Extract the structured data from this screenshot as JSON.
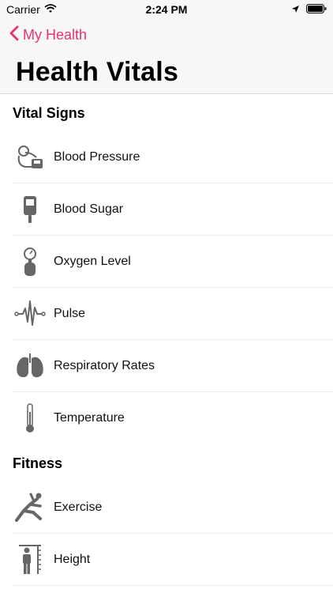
{
  "status_bar": {
    "carrier": "Carrier",
    "time": "2:24 PM"
  },
  "nav": {
    "back_label": "My Health",
    "title": "Health Vitals"
  },
  "sections": [
    {
      "header": "Vital Signs",
      "items": [
        {
          "label": "Blood Pressure",
          "icon": "blood-pressure-icon"
        },
        {
          "label": "Blood Sugar",
          "icon": "glucose-meter-icon"
        },
        {
          "label": "Oxygen Level",
          "icon": "oxygen-tank-icon"
        },
        {
          "label": "Pulse",
          "icon": "pulse-icon"
        },
        {
          "label": "Respiratory Rates",
          "icon": "lungs-icon"
        },
        {
          "label": "Temperature",
          "icon": "thermometer-icon"
        }
      ]
    },
    {
      "header": "Fitness",
      "items": [
        {
          "label": "Exercise",
          "icon": "exercise-icon"
        },
        {
          "label": "Height",
          "icon": "height-icon"
        }
      ]
    }
  ],
  "colors": {
    "accent": "#e8336c",
    "icon_gray": "#666666",
    "nav_bg": "#f7f7f7"
  }
}
